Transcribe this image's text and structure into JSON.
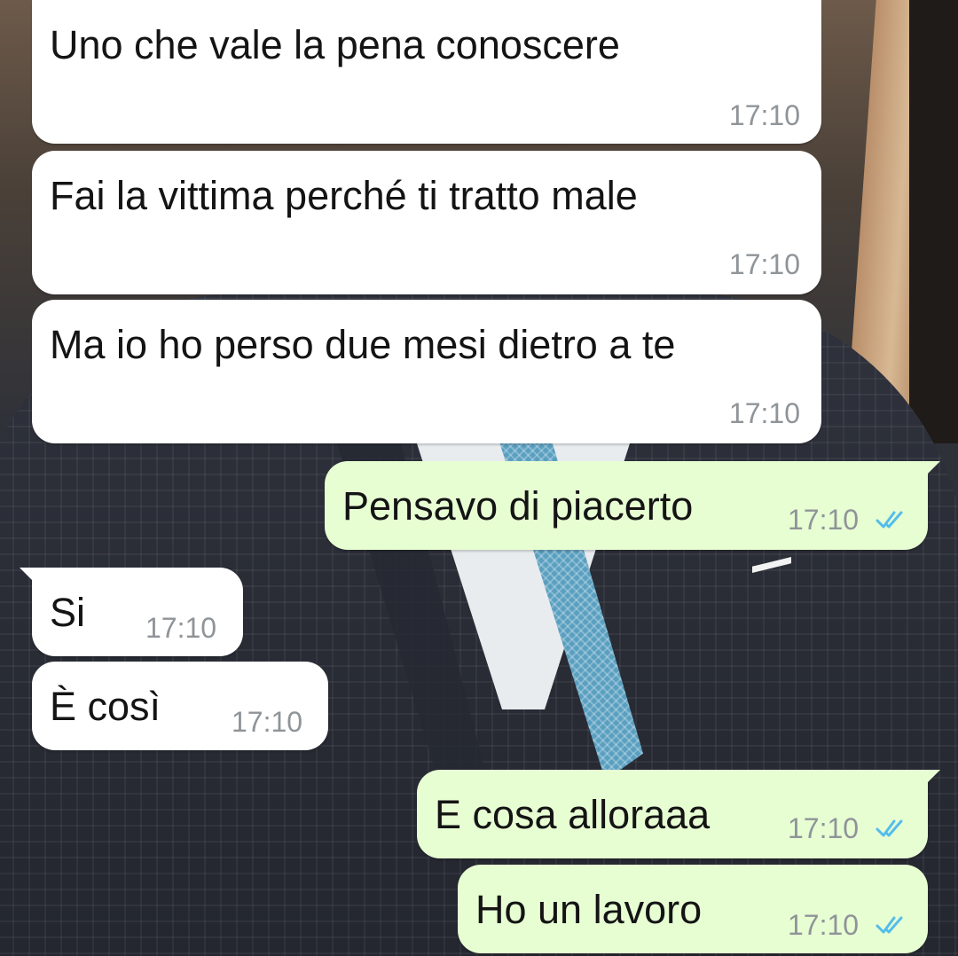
{
  "messages": [
    {
      "direction": "incoming",
      "text": "Uno che vale la pena conoscere",
      "time": "17:10"
    },
    {
      "direction": "incoming",
      "text": "Fai la vittima perché ti tratto male",
      "time": "17:10"
    },
    {
      "direction": "incoming",
      "text": "Ma io ho perso due mesi dietro a te",
      "time": "17:10"
    },
    {
      "direction": "outgoing",
      "text": "Pensavo di piacerto",
      "time": "17:10",
      "status": "read"
    },
    {
      "direction": "incoming",
      "text": "Si",
      "time": "17:10"
    },
    {
      "direction": "incoming",
      "text": "È così",
      "time": "17:10"
    },
    {
      "direction": "outgoing",
      "text": "E cosa alloraaa",
      "time": "17:10",
      "status": "read"
    },
    {
      "direction": "outgoing",
      "text": "Ho un lavoro",
      "time": "17:10",
      "status": "read"
    }
  ],
  "colors": {
    "incoming_bubble": "#ffffff",
    "outgoing_bubble": "#e7fed3",
    "read_ticks": "#53bdeb",
    "timestamp": "#8f9498"
  },
  "icons": {
    "status_read": "double-check-icon"
  }
}
